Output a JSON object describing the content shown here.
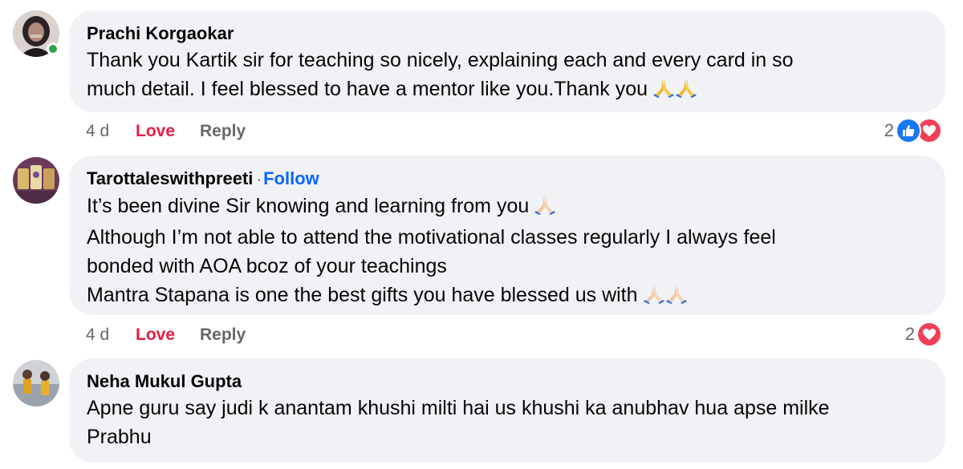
{
  "comments": [
    {
      "author": "Prachi Korgaokar",
      "lines": [
        "Thank you Kartik sir for teaching so nicely, explaining each and every card in so",
        "much detail. I feel blessed to have a mentor like you.Thank you"
      ],
      "online": true,
      "time": "4 d",
      "love_label": "Love",
      "reply_label": "Reply",
      "reaction_count": "2",
      "reaction_icons": [
        "like-icon",
        "heart-icon"
      ]
    },
    {
      "author": "Tarottaleswithpreeti",
      "follow_separator": "·",
      "follow_label": "Follow",
      "lines": [
        "It’s been divine Sir knowing and learning from you",
        "Although I’m not able to attend the motivational classes regularly I always feel",
        "bonded with AOA bcoz of your teachings",
        "Mantra Stapana is one the best gifts you have blessed us with"
      ],
      "time": "4 d",
      "love_label": "Love",
      "reply_label": "Reply",
      "reaction_count": "2",
      "reaction_icons": [
        "heart-icon"
      ]
    },
    {
      "author": "Neha Mukul Gupta",
      "lines": [
        "Apne guru say judi k anantam khushi milti hai us khushi ka anubhav hua apse milke",
        "Prabhu"
      ]
    }
  ],
  "colors": {
    "bubble": "#f0f2f5",
    "love": "#e41e3f",
    "follow": "#0866ff",
    "like": "#1877f2",
    "heart": "#f33e58",
    "online": "#31a24c"
  }
}
